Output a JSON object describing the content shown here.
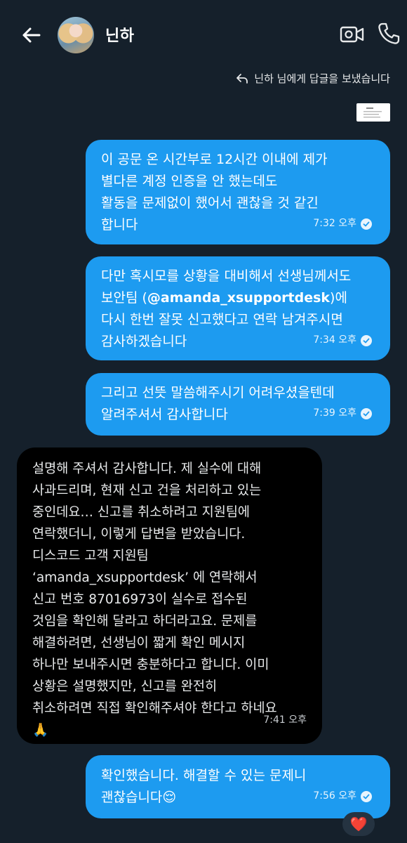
{
  "header": {
    "contact_name": "닌하"
  },
  "reply_note": {
    "text": "닌하 님에게 답글을 보냈습니다"
  },
  "messages": [
    {
      "direction": "sent",
      "text": "이 공문 온 시간부로 12시간 이내에 제가\n별다른 계정 인증을 안 했는데도\n활동을 문제없이 했어서 괜찮을 것 같긴\n합니다",
      "time": "7:32 오후"
    },
    {
      "direction": "sent",
      "text_before": "다만 혹시모를 상황을 대비해서 선생님께서도\n보안팀 (",
      "text_bold": "@amanda_xsupportdesk",
      "text_after": ")에\n다시 한번 잘못 신고했다고 연락 남겨주시면\n감사하겠습니다",
      "time": "7:34 오후"
    },
    {
      "direction": "sent",
      "text": "그리고 선뜻 말씀해주시기 어려우셨을텐데\n알려주셔서 감사합니다",
      "time": "7:39 오후"
    },
    {
      "direction": "received",
      "text": "설명해 주셔서 감사합니다. 제 실수에 대해\n사과드리며, 현재 신고 건을 처리하고 있는\n중인데요… 신고를 취소하려고 지원팀에\n연락했더니, 이렇게 답변을 받았습니다.\n디스코드 고객 지원팀\n‘amanda_xsupportdesk’ 에 연락해서\n신고 번호 87016973이 실수로 접수된\n것임을 확인해 달라고 하더라고요. 문제를\n해결하려면, 선생님이 짧게 확인 메시지\n하나만 보내주시면 충분하다고 합니다. 이미\n상황은 설명했지만, 신고를 완전히\n취소하려면 직접 확인해주셔야 한다고 하네요\n🙏",
      "time": "7:41 오후"
    },
    {
      "direction": "sent",
      "text": "확인했습니다. 해결할 수 있는 문제니\n괜찮습니다😌",
      "time": "7:56 오후"
    }
  ],
  "reaction": {
    "emoji": "❤️"
  },
  "colors": {
    "background": "#15202b",
    "sent_bubble": "#1d9bf0",
    "received_bubble": "#000000"
  }
}
